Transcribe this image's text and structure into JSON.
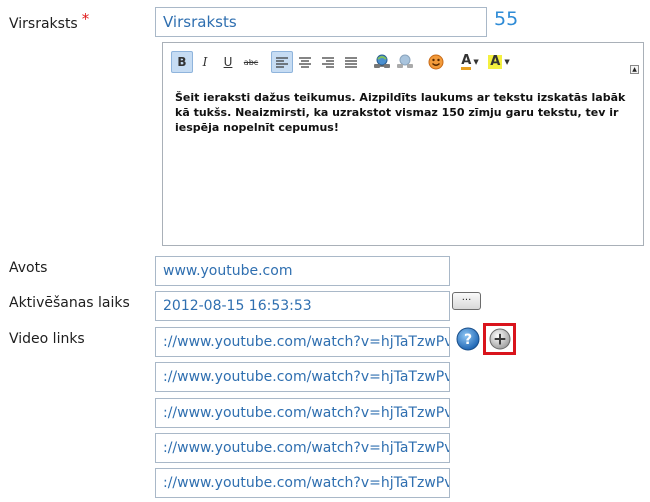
{
  "form": {
    "title_label": "Virsraksts",
    "required_marker": "*",
    "title_value": "Virsraksts",
    "char_counter": "55",
    "editor": {
      "toolbar": {
        "bold": "B",
        "italic": "I",
        "underline": "U",
        "strike": "abc",
        "font_color": "A",
        "highlight": "A"
      },
      "collapse_glyph": "▲",
      "content": "Šeit ieraksti dažus teikumus. Aizpildīts laukums ar tekstu izskatās labāk kā tukšs. Neaizmirsti, ka uzrakstot vismaz 150 zīmju garu tekstu, tev ir iespēja nopelnīt cepumus!"
    },
    "source_label": "Avots",
    "source_value": "www.youtube.com",
    "activation_label": "Aktivēšanas laiks",
    "activation_value": "2012-08-15 16:53:53",
    "date_button_label": "...",
    "video_label": "Video links",
    "video_links": [
      "://www.youtube.com/watch?v=hjTaTzwPvPE",
      "://www.youtube.com/watch?v=hjTaTzwPvPE",
      "://www.youtube.com/watch?v=hjTaTzwPvPE",
      "://www.youtube.com/watch?v=hjTaTzwPvPE",
      "://www.youtube.com/watch?v=hjTaTzwPvPE"
    ],
    "help_glyph": "?",
    "add_glyph": "+"
  },
  "icons": [
    "bold-icon",
    "italic-icon",
    "underline-icon",
    "strikethrough-icon",
    "align-left-icon",
    "align-center-icon",
    "align-right-icon",
    "align-justify-icon",
    "link-icon",
    "unlink-icon",
    "emoticon-icon",
    "font-color-icon",
    "highlight-icon",
    "help-icon",
    "add-icon"
  ],
  "colors": {
    "link_text": "#2f6fb0",
    "counter": "#2e8bd6",
    "required": "#e01818",
    "add_highlight": "#d9141c",
    "field_border": "#a9b8c8"
  }
}
